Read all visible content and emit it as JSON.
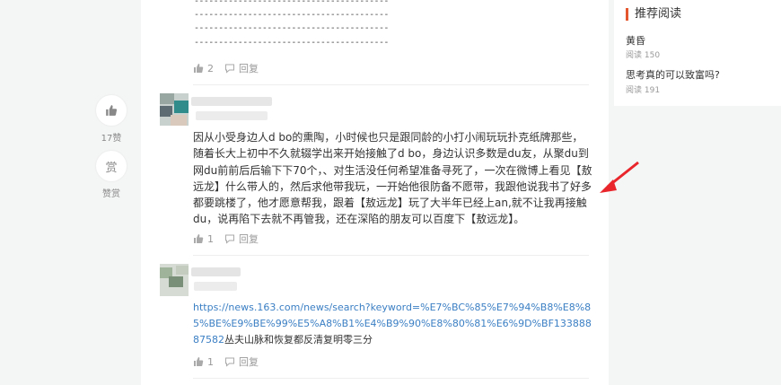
{
  "dashed_lines": [
    "----------------------------------------",
    "----------------------------------------",
    "----------------------------------------",
    "----------------------------------------"
  ],
  "comments": [
    {
      "likes": "2",
      "reply_label": "回复"
    },
    {
      "likes": "1",
      "reply_label": "回复",
      "text": "因从小受身边人d bo的熏陶，小时候也只是跟同龄的小打小闹玩玩扑克纸牌那些，随着长大上初中不久就辍学出来开始接触了d bo，身边认识多数是du友，从聚du到网du前前后后输下下70个，、对生活没任何希望准备寻死了，一次在微博上看见【敖远龙】什么带人的，然后求他带我玩，一开始他很防备不愿带，我跟他说我书了好多都要跳楼了，他才愿意帮我，跟着【敖远龙】玩了大半年已经上an,就不让我再接触du，说再陷下去就不再管我，还在深陷的朋友可以百度下【敖远龙】。"
    },
    {
      "likes": "1",
      "reply_label": "回复",
      "link": "https://news.163.com/news/search?keyword=%E7%BC%85%E7%94%B8%E8%85%BE%E9%BE%99%E5%A8%B1%E4%B9%90%E8%80%81%E6%9D%BF13388887582",
      "link_tail": "丛夫山脉和恢复都反清复明零三分"
    }
  ],
  "float_actions": {
    "like_count": "17赞",
    "reward_glyph": "赏",
    "reward_label": "赞赏"
  },
  "sidebar": {
    "title": "推荐阅读",
    "items": [
      {
        "title": "黄昏",
        "meta": "阅读 150"
      },
      {
        "title": "思考真的可以致富吗?",
        "meta": "阅读 191"
      }
    ]
  },
  "colors": {
    "accent": "#e4572e",
    "link": "#3b7fc4",
    "arrow": "#e8262b"
  }
}
